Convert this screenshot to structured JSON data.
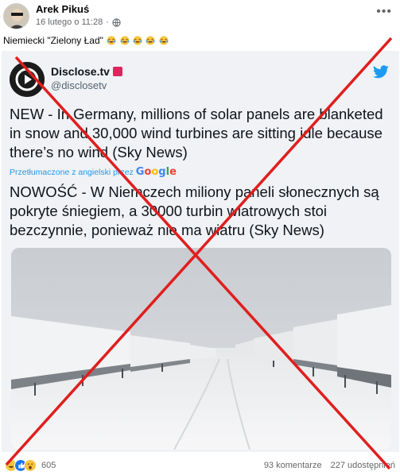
{
  "post": {
    "author": "Arek Pikuś",
    "timestamp": "16 lutego o 11:28",
    "separator": "·",
    "text": "Niemiecki \"Zielony Ład\"",
    "privacy_icon": "globe-icon",
    "more_icon": "more-options-icon"
  },
  "tweet": {
    "name": "Disclose.tv",
    "handle": "@disclosetv",
    "text_en": "NEW - In Germany, millions of solar panels are blanketed in snow and 30,000 wind turbines are sitting idle because there’s no wind (Sky News)",
    "translated_label": "Przetłumaczone z angielski przez",
    "translator": "Google",
    "text_pl": "NOWOŚĆ - W Niemczech miliony paneli słonecznych są pokryte śniegiem, a 30000 turbin wiatrowych stoi bezczynnie, ponieważ nie ma wiatru (Sky News)"
  },
  "footer": {
    "reaction_count": "605",
    "comments": "93 komentarze",
    "shares": "227 udostępnień"
  },
  "colors": {
    "cross": "#e01e1e",
    "link": "#1d9bf0",
    "card_bg": "#f0f2f5"
  }
}
